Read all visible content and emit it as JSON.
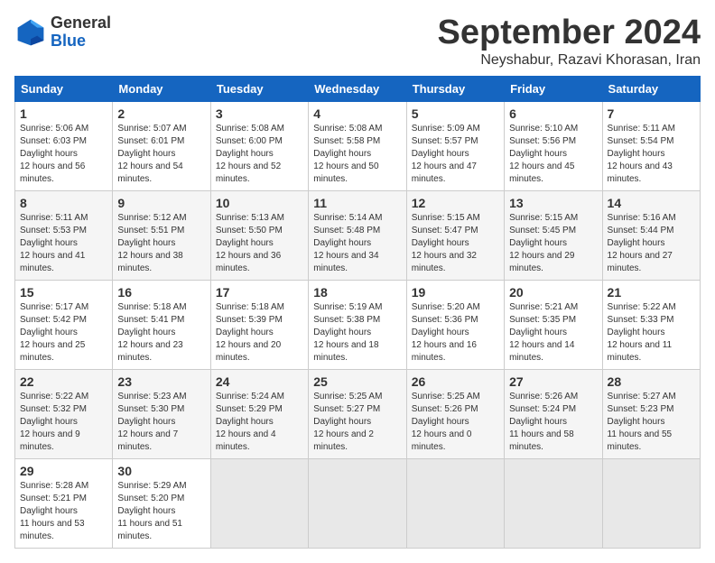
{
  "logo": {
    "general": "General",
    "blue": "Blue"
  },
  "title": "September 2024",
  "location": "Neyshabur, Razavi Khorasan, Iran",
  "days_header": [
    "Sunday",
    "Monday",
    "Tuesday",
    "Wednesday",
    "Thursday",
    "Friday",
    "Saturday"
  ],
  "weeks": [
    [
      {
        "day": "1",
        "sunrise": "5:06 AM",
        "sunset": "6:03 PM",
        "daylight": "12 hours and 56 minutes."
      },
      {
        "day": "2",
        "sunrise": "5:07 AM",
        "sunset": "6:01 PM",
        "daylight": "12 hours and 54 minutes."
      },
      {
        "day": "3",
        "sunrise": "5:08 AM",
        "sunset": "6:00 PM",
        "daylight": "12 hours and 52 minutes."
      },
      {
        "day": "4",
        "sunrise": "5:08 AM",
        "sunset": "5:58 PM",
        "daylight": "12 hours and 50 minutes."
      },
      {
        "day": "5",
        "sunrise": "5:09 AM",
        "sunset": "5:57 PM",
        "daylight": "12 hours and 47 minutes."
      },
      {
        "day": "6",
        "sunrise": "5:10 AM",
        "sunset": "5:56 PM",
        "daylight": "12 hours and 45 minutes."
      },
      {
        "day": "7",
        "sunrise": "5:11 AM",
        "sunset": "5:54 PM",
        "daylight": "12 hours and 43 minutes."
      }
    ],
    [
      {
        "day": "8",
        "sunrise": "5:11 AM",
        "sunset": "5:53 PM",
        "daylight": "12 hours and 41 minutes."
      },
      {
        "day": "9",
        "sunrise": "5:12 AM",
        "sunset": "5:51 PM",
        "daylight": "12 hours and 38 minutes."
      },
      {
        "day": "10",
        "sunrise": "5:13 AM",
        "sunset": "5:50 PM",
        "daylight": "12 hours and 36 minutes."
      },
      {
        "day": "11",
        "sunrise": "5:14 AM",
        "sunset": "5:48 PM",
        "daylight": "12 hours and 34 minutes."
      },
      {
        "day": "12",
        "sunrise": "5:15 AM",
        "sunset": "5:47 PM",
        "daylight": "12 hours and 32 minutes."
      },
      {
        "day": "13",
        "sunrise": "5:15 AM",
        "sunset": "5:45 PM",
        "daylight": "12 hours and 29 minutes."
      },
      {
        "day": "14",
        "sunrise": "5:16 AM",
        "sunset": "5:44 PM",
        "daylight": "12 hours and 27 minutes."
      }
    ],
    [
      {
        "day": "15",
        "sunrise": "5:17 AM",
        "sunset": "5:42 PM",
        "daylight": "12 hours and 25 minutes."
      },
      {
        "day": "16",
        "sunrise": "5:18 AM",
        "sunset": "5:41 PM",
        "daylight": "12 hours and 23 minutes."
      },
      {
        "day": "17",
        "sunrise": "5:18 AM",
        "sunset": "5:39 PM",
        "daylight": "12 hours and 20 minutes."
      },
      {
        "day": "18",
        "sunrise": "5:19 AM",
        "sunset": "5:38 PM",
        "daylight": "12 hours and 18 minutes."
      },
      {
        "day": "19",
        "sunrise": "5:20 AM",
        "sunset": "5:36 PM",
        "daylight": "12 hours and 16 minutes."
      },
      {
        "day": "20",
        "sunrise": "5:21 AM",
        "sunset": "5:35 PM",
        "daylight": "12 hours and 14 minutes."
      },
      {
        "day": "21",
        "sunrise": "5:22 AM",
        "sunset": "5:33 PM",
        "daylight": "12 hours and 11 minutes."
      }
    ],
    [
      {
        "day": "22",
        "sunrise": "5:22 AM",
        "sunset": "5:32 PM",
        "daylight": "12 hours and 9 minutes."
      },
      {
        "day": "23",
        "sunrise": "5:23 AM",
        "sunset": "5:30 PM",
        "daylight": "12 hours and 7 minutes."
      },
      {
        "day": "24",
        "sunrise": "5:24 AM",
        "sunset": "5:29 PM",
        "daylight": "12 hours and 4 minutes."
      },
      {
        "day": "25",
        "sunrise": "5:25 AM",
        "sunset": "5:27 PM",
        "daylight": "12 hours and 2 minutes."
      },
      {
        "day": "26",
        "sunrise": "5:25 AM",
        "sunset": "5:26 PM",
        "daylight": "12 hours and 0 minutes."
      },
      {
        "day": "27",
        "sunrise": "5:26 AM",
        "sunset": "5:24 PM",
        "daylight": "11 hours and 58 minutes."
      },
      {
        "day": "28",
        "sunrise": "5:27 AM",
        "sunset": "5:23 PM",
        "daylight": "11 hours and 55 minutes."
      }
    ],
    [
      {
        "day": "29",
        "sunrise": "5:28 AM",
        "sunset": "5:21 PM",
        "daylight": "11 hours and 53 minutes."
      },
      {
        "day": "30",
        "sunrise": "5:29 AM",
        "sunset": "5:20 PM",
        "daylight": "11 hours and 51 minutes."
      },
      null,
      null,
      null,
      null,
      null
    ]
  ]
}
